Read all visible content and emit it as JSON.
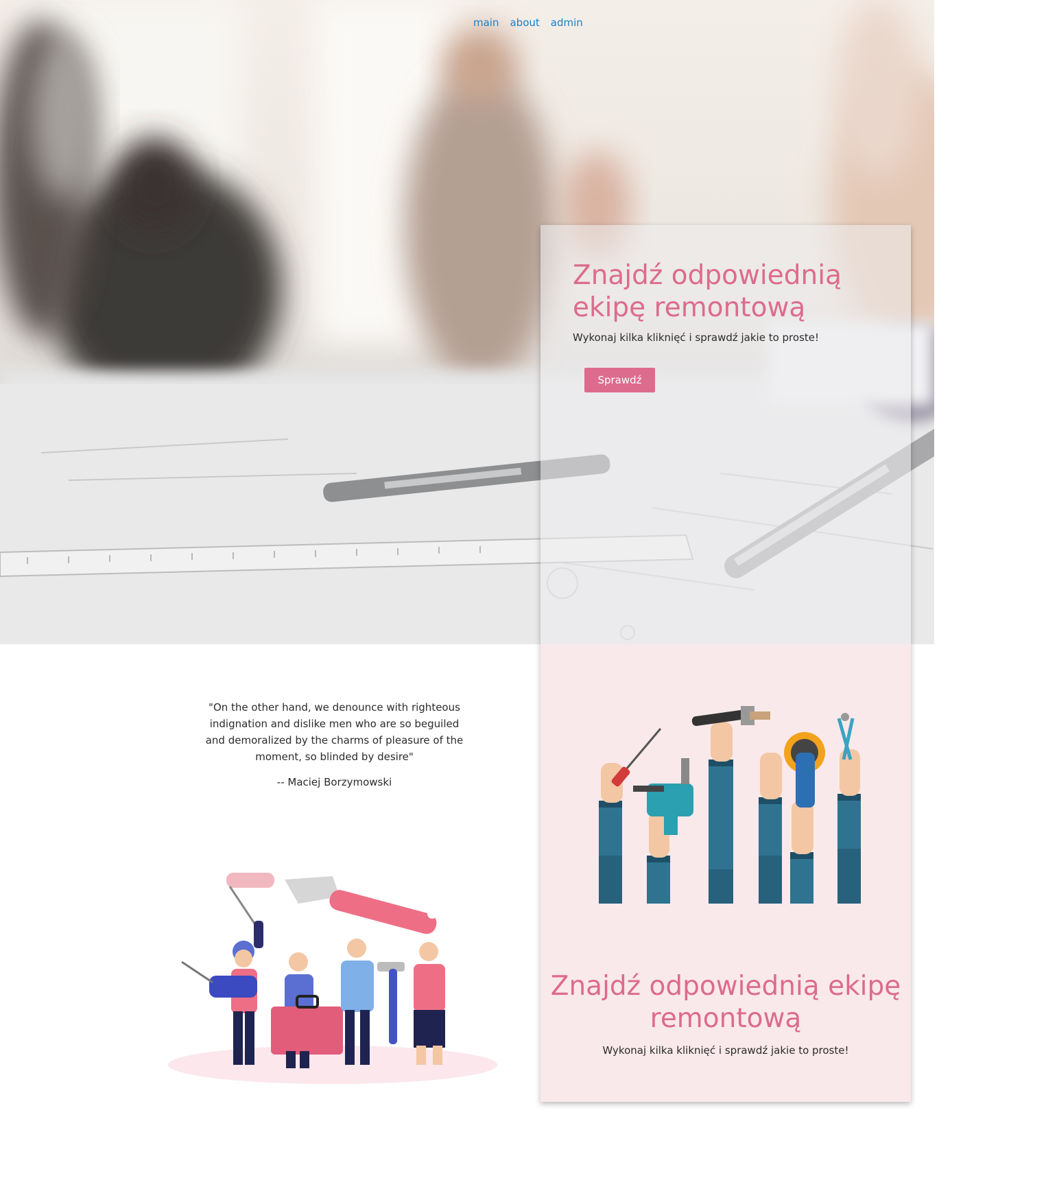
{
  "nav": {
    "items": [
      {
        "label": "main"
      },
      {
        "label": "about"
      },
      {
        "label": "admin"
      }
    ]
  },
  "hero": {
    "title": "Znajdź odpowiednią ekipę remontową",
    "subtitle": "Wykonaj kilka kliknięć i sprawdź jakie to proste!",
    "button_label": "Sprawdź"
  },
  "feature": {
    "title": "Znajdź odpowiednią ekipę remontową",
    "subtitle": "Wykonaj kilka kliknięć i sprawdź jakie to proste!"
  },
  "testimonial": {
    "quote": "\"On the other hand, we denounce with righteous indignation and dislike men who are so beguiled and demoralized by the charms of pleasure of the moment, so blinded by desire\"",
    "author": "-- Maciej Borzymowski"
  },
  "colors": {
    "accent": "#dd6b8e",
    "link": "#1e80c8",
    "card_bottom_bg": "#f9e9eb"
  },
  "icons": [
    "hero-background-photo",
    "raised-hands-tools-illustration",
    "team-with-tools-illustration"
  ]
}
